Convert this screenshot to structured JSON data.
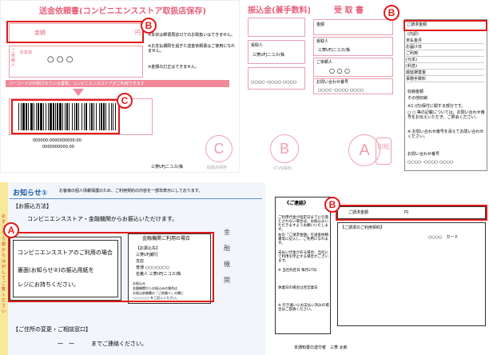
{
  "top_left": {
    "title": "送金依頼書(コンビニエンスストア取扱店保存)",
    "amount_label": "金額",
    "yen": "円",
    "requester_v": "ご依頼人",
    "name_label": "お名前",
    "name_value": "○ ○ ○",
    "notes": [
      "※本状は郵便局窓口でのお取扱いはできません。",
      "※お支払期限を過ぎた送金依頼書はご使用になれません。",
      "※金額の訂正はできません。"
    ],
    "banner": "バーコードが印刷されている書類、コンビニエンスストアがご利用できます",
    "barcode_number": "000000-0000000000-00",
    "barcode_number2": "0000000000-00",
    "bank": "三菱UFJニコス(株",
    "stamp": "C",
    "stamp_note": "取扱店保存"
  },
  "top_mid": {
    "title": "振込金(兼手数料)",
    "payee_label": "受取人",
    "payee": "三菱UFJニコス(株",
    "code": "○○○○ -○○○○ ○○○○",
    "stamp": "B",
    "stamp_note": "(CVS保存)"
  },
  "top_right": {
    "title": "受 取 書",
    "amount_label": "金額",
    "payee_label": "受取人",
    "payee": "三菱UFJニコス(株",
    "requester_label": "ご依頼人",
    "requester": "○ ○ ○",
    "contact_label": "お問い合わせ番号",
    "contact": "○○○○ -○○○○ ○○○○",
    "stamp": "A",
    "stamp_side": "印紙",
    "panel_head": "ご請求金額",
    "panel_sub": "(内訳)",
    "panel_rows": [
      "未払金月",
      "お届け日",
      "ご利用",
      "(元本)",
      "(利息)",
      "遅延損害金",
      "事務手数料"
    ],
    "panel_misc": [
      "収納金額",
      "その他収納"
    ],
    "panel_notes": [
      "※1 (内)保付に関する部分です。",
      "○ ○ 等の記載については、お問い合わせ番号をお伝えいただき、ご照会ください。",
      "※ お問い合わせ番号を添えてお問い合わせください。",
      "お問い合わせ番号",
      "○○○○ -○○○○ ○○○○"
    ]
  },
  "notice": {
    "title": "お知らせ①",
    "subtitle": "お客様の個人情報保護のため、ご利用契約の内容を一部非表示にしております。",
    "section_payment": "【お振込方法】",
    "payment_text": "コンビニエンスストア・金融機関からお振込いただけます。",
    "cvs_box": [
      "コンビニエンスストアのご利用の場合",
      "裏面(お知らせ②)の振込用紙を",
      "レジにお持ちください。"
    ],
    "bank_box_title": "金融機関ご利用の場合",
    "bank_box_lines": [
      "【お振込先】",
      "三菱UFJ銀行",
      "支店",
      "普通 ○○○○○○○",
      "名義人 三菱UFJニコス(株"
    ],
    "bank_box_note": [
      "お振込み",
      "金融機関からお振込みの場合は",
      "お振込依頼書の「ご依頼人」の欄に",
      "○○○○○○ をご記入ください。"
    ],
    "side_labels": [
      "金",
      "融",
      "機",
      "関"
    ],
    "side_note": "必ずこちら側からはがしてご覧ください",
    "section_change": "【ご住所の変更・ご相談窓口】",
    "change_text": "一　一　　　までご連絡ください。"
  },
  "contact_card": {
    "heading": "《ご連絡》",
    "body": [
      "ご利用代金が指定日までに引落とされない場合は、お振込みいただきますようお願いいたします。",
      "右の「ご請求金額」を送金依頼書等に記入し、ご利用になれます。",
      "未払い代金がある場合、当社にて利用を停止する場合がございます。",
      "※ 当社約定日 毎月27日",
      "休業日の場合は翌営業日",
      "※ 行き違いにお支払い済みの場合はご容赦ください。"
    ],
    "amount_label": "ご請求金額",
    "yen": "円",
    "contract_label": "【ご請求のご利用契約】",
    "card_line": "○○○○　カード",
    "footer": "本通知書の送付者　三菱 太郎"
  },
  "markers": {
    "A": "A",
    "B": "B",
    "C": "C"
  }
}
